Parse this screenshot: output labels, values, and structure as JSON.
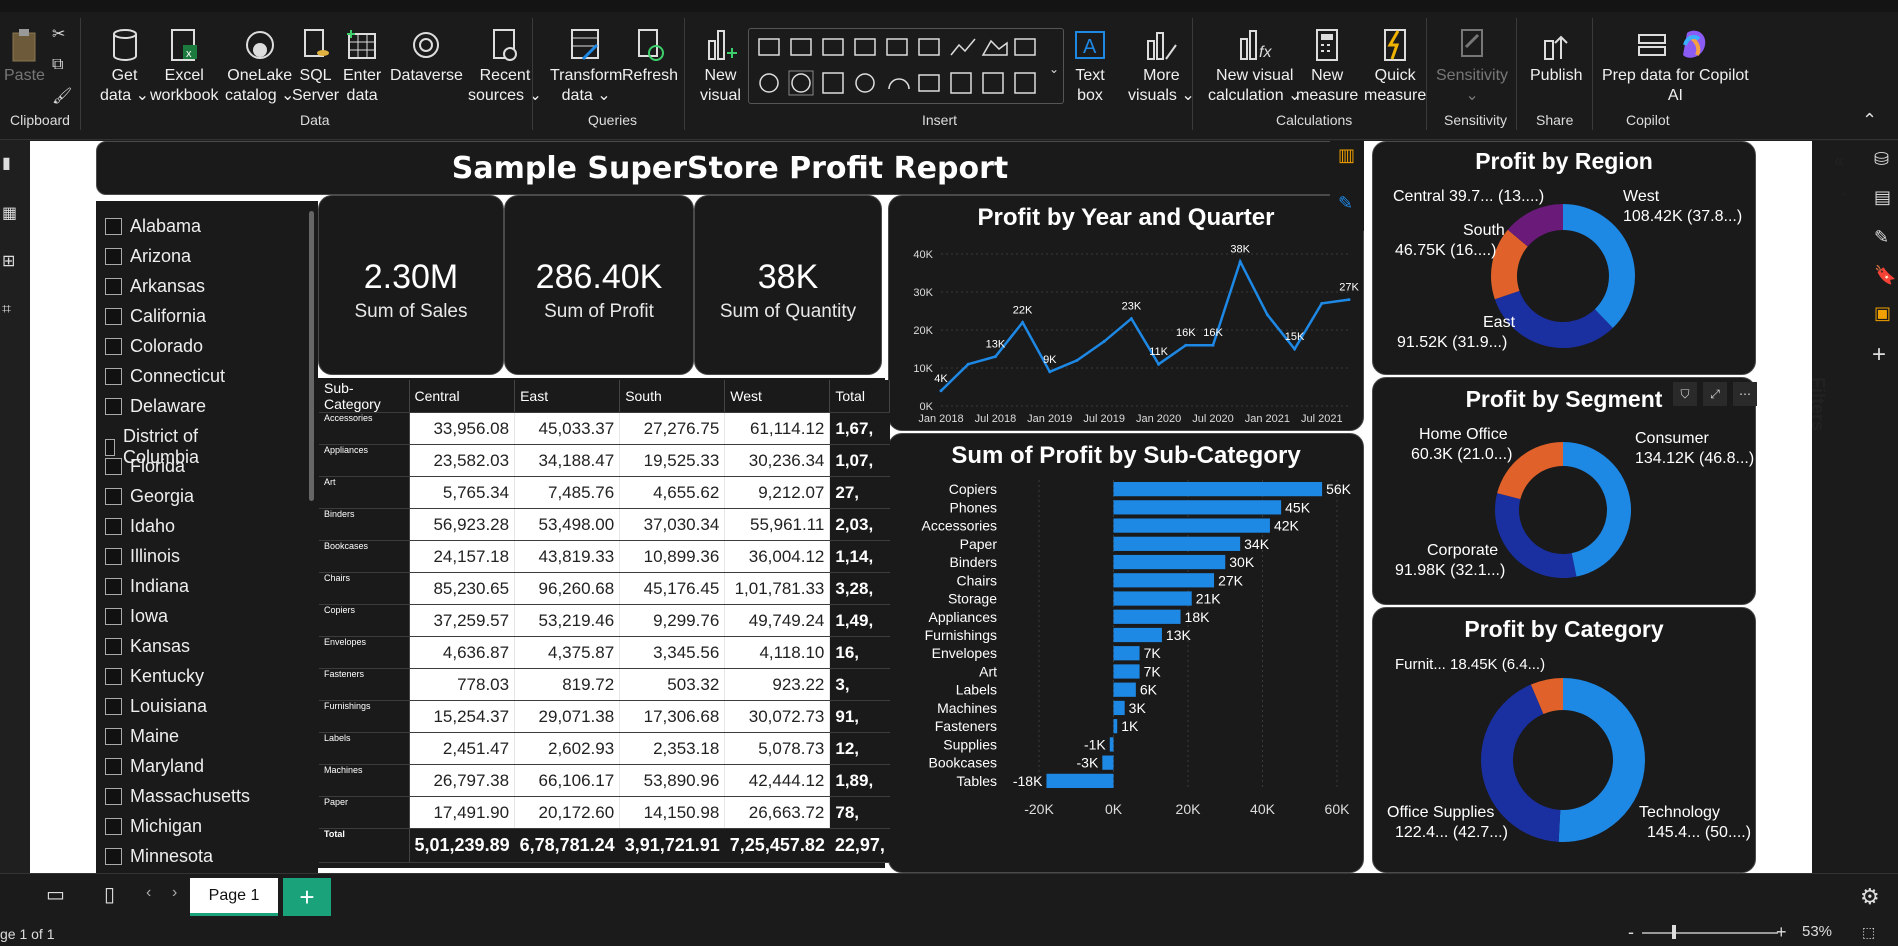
{
  "ribbon": {
    "clipboard": {
      "paste": "Paste",
      "group": "Clipboard"
    },
    "data": {
      "get_data": "Get\ndata ⌄",
      "excel": "Excel\nworkbook",
      "onelake": "OneLake\ncatalog ⌄",
      "sql": "SQL\nServer",
      "enter": "Enter\ndata",
      "dataverse": "Dataverse",
      "recent": "Recent\nsources ⌄",
      "group": "Data"
    },
    "queries": {
      "transform": "Transform\ndata ⌄",
      "refresh": "Refresh",
      "group": "Queries"
    },
    "insert": {
      "new_visual": "New\nvisual",
      "text_box": "Text\nbox",
      "more_visuals": "More\nvisuals ⌄",
      "group": "Insert"
    },
    "calculations": {
      "new_visual_calc": "New visual\ncalculation ⌄",
      "new_measure": "New\nmeasure",
      "quick_measure": "Quick\nmeasure",
      "group": "Calculations"
    },
    "sensitivity": {
      "label": "Sensitivity\n⌄",
      "group": "Sensitivity"
    },
    "share": {
      "publish": "Publish",
      "group": "Share"
    },
    "copilot": {
      "prep": "Prep data for Copilot\nAI",
      "group": "Copilot"
    }
  },
  "report": {
    "title": "Sample SuperStore Profit Report",
    "kpis": [
      {
        "value": "2.30M",
        "label": "Sum of Sales"
      },
      {
        "value": "286.40K",
        "label": "Sum of Profit"
      },
      {
        "value": "38K",
        "label": "Sum of Quantity"
      }
    ],
    "states": [
      "Alabama",
      "Arizona",
      "Arkansas",
      "California",
      "Colorado",
      "Connecticut",
      "Delaware",
      "District of Columbia",
      "Florida",
      "Georgia",
      "Idaho",
      "Illinois",
      "Indiana",
      "Iowa",
      "Kansas",
      "Kentucky",
      "Louisiana",
      "Maine",
      "Maryland",
      "Massachusetts",
      "Michigan",
      "Minnesota"
    ],
    "matrix": {
      "headers": [
        "Sub-Category",
        "Central",
        "East",
        "South",
        "West",
        "Total"
      ],
      "rows": [
        [
          "Accessories",
          "33,956.08",
          "45,033.37",
          "27,276.75",
          "61,114.12",
          "1,67,"
        ],
        [
          "Appliances",
          "23,582.03",
          "34,188.47",
          "19,525.33",
          "30,236.34",
          "1,07,"
        ],
        [
          "Art",
          "5,765.34",
          "7,485.76",
          "4,655.62",
          "9,212.07",
          "27,"
        ],
        [
          "Binders",
          "56,923.28",
          "53,498.00",
          "37,030.34",
          "55,961.11",
          "2,03,"
        ],
        [
          "Bookcases",
          "24,157.18",
          "43,819.33",
          "10,899.36",
          "36,004.12",
          "1,14,"
        ],
        [
          "Chairs",
          "85,230.65",
          "96,260.68",
          "45,176.45",
          "1,01,781.33",
          "3,28,"
        ],
        [
          "Copiers",
          "37,259.57",
          "53,219.46",
          "9,299.76",
          "49,749.24",
          "1,49,"
        ],
        [
          "Envelopes",
          "4,636.87",
          "4,375.87",
          "3,345.56",
          "4,118.10",
          "16,"
        ],
        [
          "Fasteners",
          "778.03",
          "819.72",
          "503.32",
          "923.22",
          "3,"
        ],
        [
          "Furnishings",
          "15,254.37",
          "29,071.38",
          "17,306.68",
          "30,072.73",
          "91,"
        ],
        [
          "Labels",
          "2,451.47",
          "2,602.93",
          "2,353.18",
          "5,078.73",
          "12,"
        ],
        [
          "Machines",
          "26,797.38",
          "66,106.17",
          "53,890.96",
          "42,444.12",
          "1,89,"
        ],
        [
          "Paper",
          "17,491.90",
          "20,172.60",
          "14,150.98",
          "26,663.72",
          "78,"
        ]
      ],
      "total": [
        "Total",
        "5,01,239.89",
        "6,78,781.24",
        "3,91,721.91",
        "7,25,457.82",
        "22,97,"
      ]
    },
    "line_title": "Profit by Year and Quarter",
    "bar_title": "Sum of Profit by Sub-Category",
    "region_title": "Profit by Region",
    "segment_title": "Profit by Segment",
    "category_title": "Profit by Category",
    "region_labels": [
      "Central 39.7... (13....)",
      "West",
      "108.42K (37.8...)",
      "South",
      "46.75K (16....)",
      "East",
      "91.52K (31.9...)"
    ],
    "segment_labels": [
      "Home Office",
      "60.3K (21.0...)",
      "Consumer",
      "134.12K (46.8...)",
      "Corporate",
      "91.98K (32.1...)"
    ],
    "category_labels": [
      "Furnit... 18.45K (6.4...)",
      "Office Supplies",
      "122.4... (42.7...)",
      "Technology",
      "145.4... (50....)"
    ]
  },
  "chart_data": [
    {
      "type": "line",
      "title": "Profit by Year and Quarter",
      "x": [
        "2018 Q1",
        "2018 Q2",
        "2018 Q3",
        "2018 Q4",
        "2019 Q1",
        "2019 Q2",
        "2019 Q3",
        "2019 Q4",
        "2020 Q1",
        "2020 Q2",
        "2020 Q3",
        "2020 Q4",
        "2021 Q1",
        "2021 Q2",
        "2021 Q3",
        "2021 Q4"
      ],
      "x_ticks": [
        "Jan 2018",
        "Jul 2018",
        "Jan 2019",
        "Jul 2019",
        "Jan 2020",
        "Jul 2020",
        "Jan 2021",
        "Jul 2021"
      ],
      "y_ticks": [
        "0K",
        "10K",
        "20K",
        "30K",
        "40K"
      ],
      "values": [
        4,
        11,
        13,
        22,
        9,
        12,
        17,
        23,
        11,
        16,
        16,
        38,
        24,
        15,
        27,
        28
      ],
      "point_labels": [
        "4K",
        "",
        "13K",
        "22K",
        "9K",
        "",
        "",
        "23K",
        "11K",
        "16K",
        "16K",
        "38K",
        "",
        "15K",
        "",
        "27K"
      ],
      "ylim": [
        0,
        40
      ],
      "color": "#1e88e5"
    },
    {
      "type": "bar",
      "title": "Sum of Profit by Sub-Category",
      "categories": [
        "Copiers",
        "Phones",
        "Accessories",
        "Paper",
        "Binders",
        "Chairs",
        "Storage",
        "Appliances",
        "Furnishings",
        "Envelopes",
        "Art",
        "Labels",
        "Machines",
        "Fasteners",
        "Supplies",
        "Bookcases",
        "Tables"
      ],
      "values": [
        56,
        45,
        42,
        34,
        30,
        27,
        21,
        18,
        13,
        7,
        7,
        6,
        3,
        1,
        -1,
        -3,
        -18
      ],
      "labels": [
        "56K",
        "45K",
        "42K",
        "34K",
        "30K",
        "27K",
        "21K",
        "18K",
        "13K",
        "7K",
        "7K",
        "6K",
        "3K",
        "1K",
        "-1K",
        "-3K",
        "-18K"
      ],
      "x_ticks": [
        "-20K",
        "0K",
        "20K",
        "40K",
        "60K"
      ],
      "xlim": [
        -20,
        60
      ],
      "color": "#1e88e5"
    },
    {
      "type": "pie",
      "title": "Profit by Region",
      "categories": [
        "West",
        "East",
        "South",
        "Central"
      ],
      "values": [
        37.8,
        31.9,
        16.3,
        13.9
      ],
      "colors": [
        "#1e88e5",
        "#1a2fa0",
        "#e0622a",
        "#6a1b7a"
      ]
    },
    {
      "type": "pie",
      "title": "Profit by Segment",
      "categories": [
        "Consumer",
        "Corporate",
        "Home Office"
      ],
      "values": [
        46.8,
        32.1,
        21.0
      ],
      "colors": [
        "#1e88e5",
        "#1a2fa0",
        "#e0622a"
      ]
    },
    {
      "type": "pie",
      "title": "Profit by Category",
      "categories": [
        "Technology",
        "Office Supplies",
        "Furniture"
      ],
      "values": [
        50.8,
        42.7,
        6.4
      ],
      "colors": [
        "#1e88e5",
        "#1a2fa0",
        "#e0622a"
      ]
    }
  ],
  "footer": {
    "page_tab": "Page 1",
    "add": "+",
    "page_count": "ge 1 of 1",
    "zoom": "53%",
    "filters": "Filters"
  }
}
